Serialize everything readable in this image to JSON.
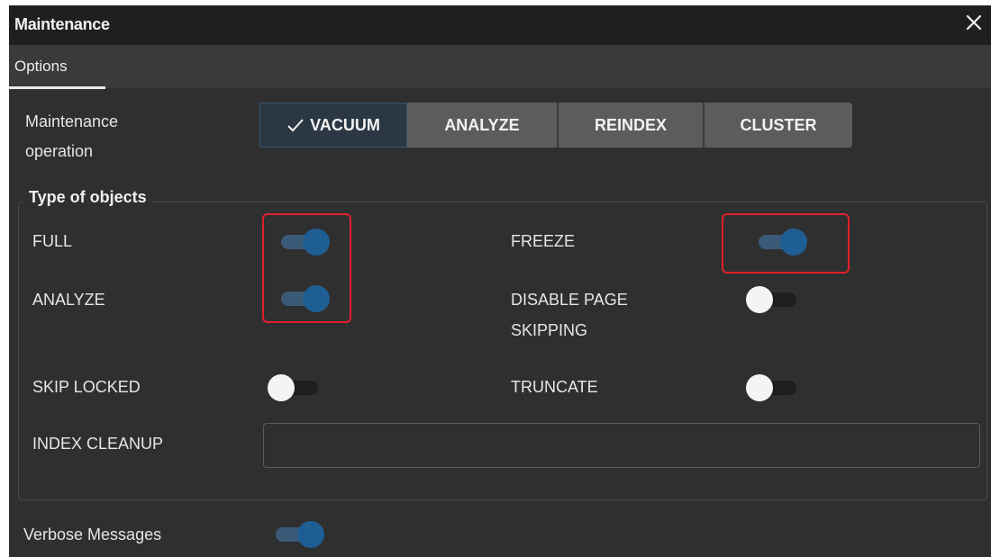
{
  "dialog": {
    "title": "Maintenance",
    "close_icon": "close-icon"
  },
  "tabs": [
    {
      "label": "Options",
      "active": true
    }
  ],
  "operation": {
    "label_line1": "Maintenance",
    "label_line2": "operation",
    "options": [
      {
        "label": "VACUUM",
        "selected": true
      },
      {
        "label": "ANALYZE",
        "selected": false
      },
      {
        "label": "REINDEX",
        "selected": false
      },
      {
        "label": "CLUSTER",
        "selected": false
      }
    ]
  },
  "objects": {
    "legend": "Type of objects",
    "full": {
      "label": "FULL",
      "on": true
    },
    "freeze": {
      "label": "FREEZE",
      "on": true
    },
    "analyze": {
      "label": "ANALYZE",
      "on": true
    },
    "disable_page_skipping": {
      "label_line1": "DISABLE PAGE",
      "label_line2": "SKIPPING",
      "on": false
    },
    "skip_locked": {
      "label": "SKIP LOCKED",
      "on": false
    },
    "truncate": {
      "label": "TRUNCATE",
      "on": false
    },
    "index_cleanup": {
      "label": "INDEX CLEANUP",
      "value": ""
    }
  },
  "verbose": {
    "label": "Verbose Messages",
    "on": true
  },
  "colors": {
    "toggle_on": "#1f5e92",
    "highlight": "#e0202a",
    "background": "#2f2f2f"
  }
}
